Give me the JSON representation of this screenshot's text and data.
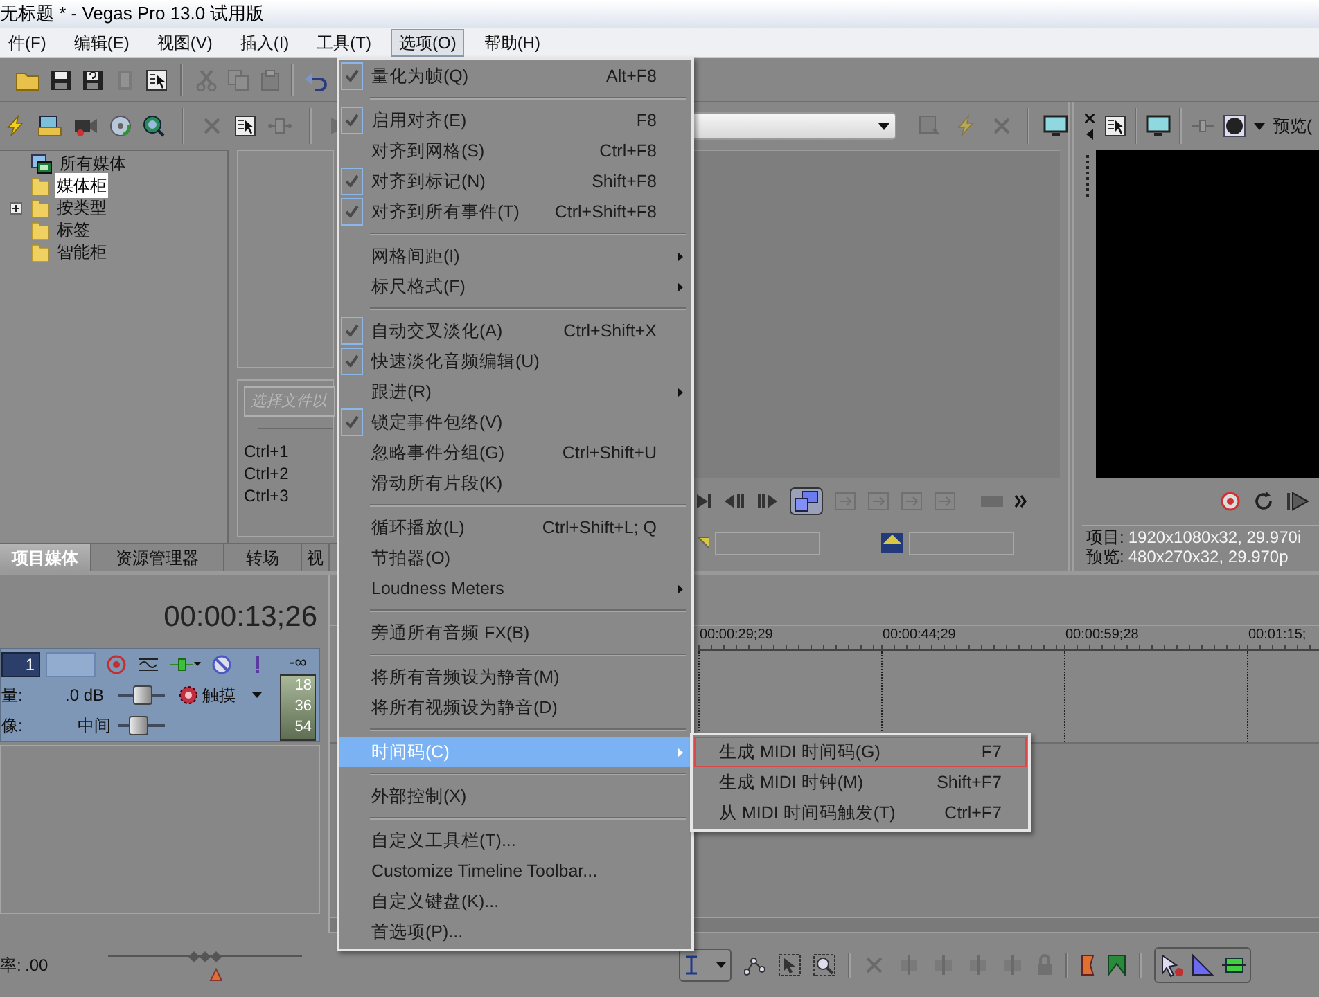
{
  "window": {
    "title": "无标题 * - Vegas Pro 13.0 试用版"
  },
  "menu_bar": [
    {
      "label": "件(F)",
      "selected": false
    },
    {
      "label": "编辑(E)",
      "selected": false
    },
    {
      "label": "视图(V)",
      "selected": false
    },
    {
      "label": "插入(I)",
      "selected": false
    },
    {
      "label": "工具(T)",
      "selected": false
    },
    {
      "label": "选项(O)",
      "selected": true
    },
    {
      "label": "帮助(H)",
      "selected": false
    }
  ],
  "options_menu": {
    "groups": [
      [
        {
          "label": "量化为帧(Q)",
          "shortcut": "Alt+F8",
          "checked": true,
          "has_submenu": false,
          "selected": false
        }
      ],
      [
        {
          "label": "启用对齐(E)",
          "shortcut": "F8",
          "checked": true,
          "has_submenu": false,
          "selected": false
        },
        {
          "label": "对齐到网格(S)",
          "shortcut": "Ctrl+F8",
          "checked": false,
          "has_submenu": false,
          "selected": false
        },
        {
          "label": "对齐到标记(N)",
          "shortcut": "Shift+F8",
          "checked": true,
          "has_submenu": false,
          "selected": false
        },
        {
          "label": "对齐到所有事件(T)",
          "shortcut": "Ctrl+Shift+F8",
          "checked": true,
          "has_submenu": false,
          "selected": false
        }
      ],
      [
        {
          "label": "网格间距(I)",
          "checked": false,
          "has_submenu": true,
          "selected": false
        },
        {
          "label": "标尺格式(F)",
          "checked": false,
          "has_submenu": true,
          "selected": false
        }
      ],
      [
        {
          "label": "自动交叉淡化(A)",
          "shortcut": "Ctrl+Shift+X",
          "checked": true,
          "has_submenu": false,
          "selected": false
        },
        {
          "label": "快速淡化音频编辑(U)",
          "checked": true,
          "has_submenu": false,
          "selected": false
        },
        {
          "label": "跟进(R)",
          "checked": false,
          "has_submenu": true,
          "selected": false
        },
        {
          "label": "锁定事件包络(V)",
          "checked": true,
          "has_submenu": false,
          "selected": false
        },
        {
          "label": "忽略事件分组(G)",
          "shortcut": "Ctrl+Shift+U",
          "checked": false,
          "has_submenu": false,
          "selected": false
        },
        {
          "label": "滑动所有片段(K)",
          "checked": false,
          "has_submenu": false,
          "selected": false
        }
      ],
      [
        {
          "label": "循环播放(L)",
          "shortcut": "Ctrl+Shift+L; Q",
          "checked": false,
          "has_submenu": false,
          "selected": false
        },
        {
          "label": "节拍器(O)",
          "checked": false,
          "has_submenu": false,
          "selected": false
        },
        {
          "label": "Loudness Meters",
          "checked": false,
          "has_submenu": true,
          "selected": false
        }
      ],
      [
        {
          "label": "旁通所有音频 FX(B)",
          "checked": false,
          "has_submenu": false,
          "selected": false
        }
      ],
      [
        {
          "label": "将所有音频设为静音(M)",
          "checked": false,
          "has_submenu": false,
          "selected": false
        },
        {
          "label": "将所有视频设为静音(D)",
          "checked": false,
          "has_submenu": false,
          "selected": false
        }
      ],
      [
        {
          "label": "时间码(C)",
          "checked": false,
          "has_submenu": true,
          "selected": true
        }
      ],
      [
        {
          "label": "外部控制(X)",
          "checked": false,
          "has_submenu": false,
          "selected": false
        }
      ],
      [
        {
          "label": "自定义工具栏(T)...",
          "checked": false,
          "has_submenu": false,
          "selected": false
        },
        {
          "label": "Customize Timeline Toolbar...",
          "checked": false,
          "has_submenu": false,
          "selected": false
        },
        {
          "label": "自定义键盘(K)...",
          "checked": false,
          "has_submenu": false,
          "selected": false
        },
        {
          "label": "首选项(P)...",
          "checked": false,
          "has_submenu": false,
          "selected": false
        }
      ]
    ]
  },
  "timecode_submenu": {
    "items": [
      {
        "label": "生成 MIDI 时间码(G)",
        "shortcut": "F7",
        "selected": true
      },
      {
        "label": "生成 MIDI 时钟(M)",
        "shortcut": "Shift+F7",
        "selected": false
      },
      {
        "label": "从 MIDI 时间码触发(T)",
        "shortcut": "Ctrl+F7",
        "selected": false
      }
    ]
  },
  "explorer": {
    "tree": [
      {
        "label": "所有媒体",
        "kind": "media",
        "selected": false,
        "collapsed": false
      },
      {
        "label": "媒体柜",
        "kind": "folder",
        "selected": true,
        "collapsed": false
      },
      {
        "label": "按类型",
        "kind": "folder",
        "selected": false,
        "collapsed": true
      },
      {
        "label": "标签",
        "kind": "folder",
        "selected": false,
        "collapsed": false
      },
      {
        "label": "智能柜",
        "kind": "folder",
        "selected": false,
        "collapsed": false
      }
    ],
    "search": {
      "placeholder": "选择文件以"
    },
    "shortcuts": [
      "Ctrl+1",
      "Ctrl+2",
      "Ctrl+3"
    ]
  },
  "panel_tabs": [
    {
      "label": "项目媒体",
      "selected": true
    },
    {
      "label": "资源管理器",
      "selected": false
    },
    {
      "label": "转场",
      "selected": false
    },
    {
      "label": "视",
      "selected": false
    }
  ],
  "preview": {
    "title": "预览(",
    "info": [
      {
        "label": "项目:",
        "value": "1920x1080x32, 29.970i"
      },
      {
        "label": "预览:",
        "value": "480x270x32, 29.970p"
      }
    ]
  },
  "timeline": {
    "time": "00:00:13;26",
    "track": {
      "number": "1",
      "peak": "-∞",
      "volume": {
        "label": "量:",
        "value": ".0 dB",
        "level": 0.55
      },
      "automation": "触摸",
      "pan": {
        "label": "像:",
        "value": "中间",
        "level": 0.4
      },
      "meter_ticks": [
        "18",
        "36",
        "54"
      ]
    },
    "ruler": [
      "00:00:29;29",
      "00:00:44;29",
      "00:00:59;28",
      "00:01:15;"
    ],
    "rate": {
      "label": "率:",
      "value": ".00",
      "level": 0.5
    }
  }
}
